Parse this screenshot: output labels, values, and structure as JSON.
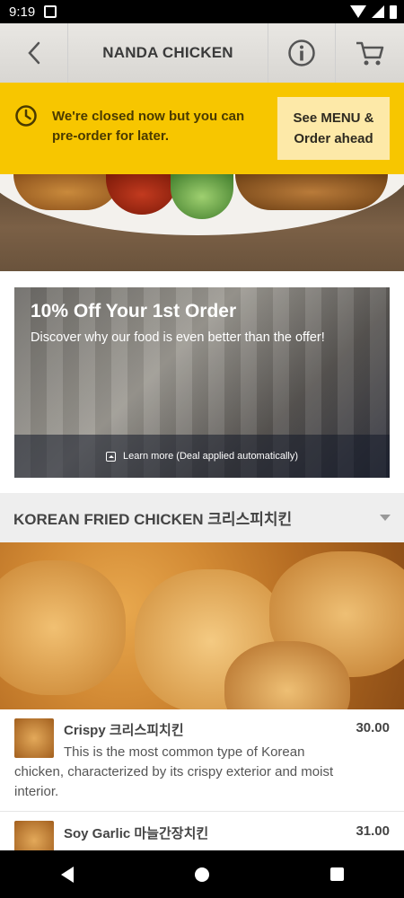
{
  "status_bar": {
    "time": "9:19"
  },
  "header": {
    "title": "NANDA CHICKEN",
    "back_icon": "back-arrow-icon",
    "info_icon": "info-icon",
    "cart_icon": "cart-icon"
  },
  "closed_banner": {
    "message": "We're closed now but you can pre-order for later.",
    "button_label": "See MENU & Order ahead",
    "background": "#f7c600"
  },
  "promo": {
    "title": "10% Off Your 1st Order",
    "subtitle": "Discover why our food is even better than the offer!",
    "learn_more": "Learn more (Deal applied automatically)"
  },
  "category": {
    "label": "KOREAN FRIED CHICKEN 크리스피치킨"
  },
  "menu_items": [
    {
      "name": "Crispy 크리스피치킨",
      "price": "30.00",
      "description": "This is the most common type of Korean chicken, characterized by its crispy exterior and moist interior."
    },
    {
      "name": "Soy Garlic 마늘간장치킨",
      "price": "31.00",
      "description": ""
    }
  ]
}
